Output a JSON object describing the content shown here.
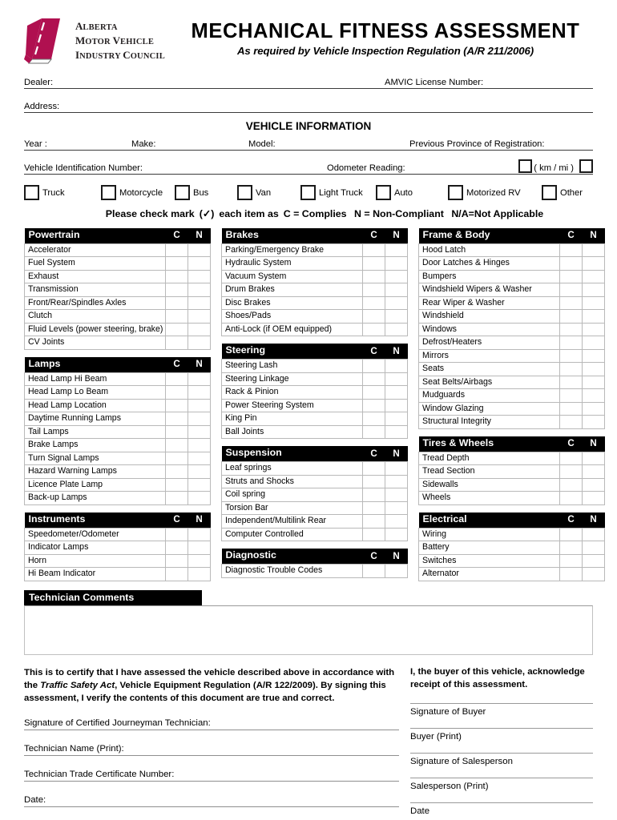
{
  "header": {
    "logo_lines": [
      {
        "cap": "A",
        "rest": "LBERTA"
      },
      {
        "cap": "M",
        "rest": "OTOR ",
        "cap2": "V",
        "rest2": "EHICLE"
      },
      {
        "cap": "I",
        "rest": "NDUSTRY ",
        "cap2": "C",
        "rest2": "OUNCIL"
      }
    ],
    "logo_color": "#B01050",
    "title": "MECHANICAL  FITNESS  ASSESSMENT",
    "subtitle": "As required by Vehicle Inspection Regulation (A/R 211/2006)"
  },
  "dealer_fields": {
    "dealer_label": "Dealer:",
    "amvic_label": "AMVIC License Number:",
    "address_label": "Address:"
  },
  "vehicle_info": {
    "heading": "VEHICLE INFORMATION",
    "year_label": "Year :",
    "make_label": "Make:",
    "model_label": "Model:",
    "province_label": "Previous Province of Registration:",
    "vin_label": "Vehicle Identification Number:",
    "odometer_label": "Odometer Reading:",
    "units_label": "( km / mi )"
  },
  "vehicle_types": [
    "Truck",
    "Motorcycle",
    "Bus",
    "Van",
    "Light Truck",
    "Auto",
    "Motorized RV",
    "Other"
  ],
  "legend": {
    "prefix": "Please check mark",
    "check": "(✓)",
    "mid": "each item as",
    "complies": "C = Complies",
    "noncompliant": "N = Non-Compliant",
    "na": "N/A=Not Applicable"
  },
  "table_columns": {
    "c": "C",
    "n": "N"
  },
  "checklist": {
    "left": [
      {
        "title": "Powertrain",
        "items": [
          "Accelerator",
          "Fuel System",
          "Exhaust",
          "Transmission",
          "Front/Rear/Spindles Axles",
          "Clutch",
          "Fluid Levels (power steering, brake)",
          "CV Joints"
        ]
      },
      {
        "title": "Lamps",
        "items": [
          "Head Lamp Hi Beam",
          "Head Lamp Lo Beam",
          "Head Lamp Location",
          "Daytime Running Lamps",
          "Tail Lamps",
          "Brake Lamps",
          "Turn Signal Lamps",
          "Hazard Warning Lamps",
          "Licence Plate Lamp",
          "Back-up Lamps"
        ]
      },
      {
        "title": "Instruments",
        "items": [
          "Speedometer/Odometer",
          "Indicator Lamps",
          "Horn",
          "Hi Beam Indicator"
        ]
      }
    ],
    "middle": [
      {
        "title": "Brakes",
        "items": [
          "Parking/Emergency Brake",
          "Hydraulic System",
          "Vacuum System",
          "Drum Brakes",
          "Disc Brakes",
          "Shoes/Pads",
          "Anti-Lock (if OEM equipped)"
        ]
      },
      {
        "title": "Steering",
        "items": [
          "Steering Lash",
          "Steering Linkage",
          "Rack & Pinion",
          "Power Steering System",
          "King Pin",
          "Ball Joints"
        ]
      },
      {
        "title": "Suspension",
        "items": [
          "Leaf springs",
          "Struts and Shocks",
          "Coil spring",
          "Torsion Bar",
          "Independent/Multilink Rear",
          "Computer Controlled"
        ]
      },
      {
        "title": "Diagnostic",
        "items": [
          "Diagnostic Trouble Codes"
        ]
      }
    ],
    "right": [
      {
        "title": "Frame & Body",
        "items": [
          "Hood Latch",
          "Door Latches & Hinges",
          "Bumpers",
          "Windshield Wipers & Washer",
          "Rear Wiper & Washer",
          "Windshield",
          "Windows",
          "Defrost/Heaters",
          "Mirrors",
          "Seats",
          "Seat Belts/Airbags",
          "Mudguards",
          "Window Glazing",
          "Structural Integrity"
        ]
      },
      {
        "title": "Tires & Wheels",
        "items": [
          "Tread Depth",
          "Tread Section",
          "Sidewalls",
          "Wheels"
        ]
      },
      {
        "title": "Electrical",
        "items": [
          "Wiring",
          "Battery",
          "Switches",
          "Alternator"
        ]
      }
    ]
  },
  "comments": {
    "title": "Technician Comments"
  },
  "footer": {
    "certification": {
      "part1": "This is to certify that I have assessed the vehicle described above in accordance with the ",
      "italic": "Traffic Safety Act",
      "part2": ", Vehicle Equipment Regulation (A/R 122/2009).  By signing this assessment, I verify the contents of this document are true and correct."
    },
    "technician_lines": [
      "Signature of Certified Journeyman Technician:",
      "Technician Name (Print):",
      "Technician Trade Certificate Number:",
      "Date:"
    ],
    "buyer_heading": "I, the buyer of this vehicle, acknowledge receipt of this assessment.",
    "buyer_lines": [
      "Signature of Buyer",
      "Buyer (Print)",
      "Signature of Salesperson",
      "Salesperson (Print)",
      "Date"
    ]
  }
}
